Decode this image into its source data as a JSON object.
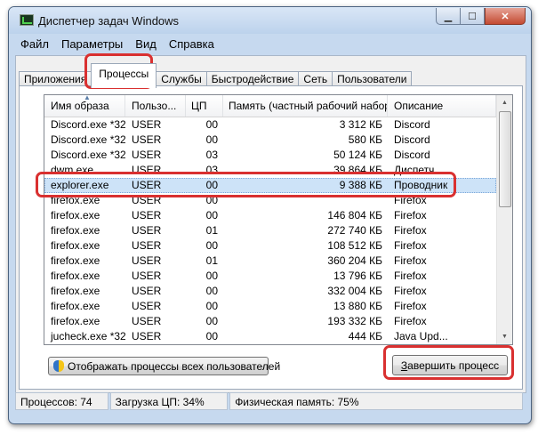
{
  "window": {
    "title": "Диспетчер задач Windows"
  },
  "menu": [
    "Файл",
    "Параметры",
    "Вид",
    "Справка"
  ],
  "tabs": [
    "Приложения",
    "Процессы",
    "Службы",
    "Быстродействие",
    "Сеть",
    "Пользователи"
  ],
  "active_tab": "Процессы",
  "table": {
    "columns": [
      "Имя образа",
      "Пользо...",
      "ЦП",
      "Память (частный рабочий набор)",
      "Описание"
    ],
    "sorted_column": "Имя образа",
    "rows": [
      [
        "Discord.exe *32",
        "USER",
        "00",
        "3 312 КБ",
        "Discord"
      ],
      [
        "Discord.exe *32",
        "USER",
        "00",
        "580 КБ",
        "Discord"
      ],
      [
        "Discord.exe *32",
        "USER",
        "03",
        "50 124 КБ",
        "Discord"
      ],
      [
        "dwm.exe",
        "USER",
        "03",
        "39 864 КБ",
        "Диспетч..."
      ],
      [
        "explorer.exe",
        "USER",
        "00",
        "9 388 КБ",
        "Проводник"
      ],
      [
        "firefox.exe",
        "USER",
        "00",
        "",
        "Firefox"
      ],
      [
        "firefox.exe",
        "USER",
        "00",
        "146 804 КБ",
        "Firefox"
      ],
      [
        "firefox.exe",
        "USER",
        "01",
        "272 740 КБ",
        "Firefox"
      ],
      [
        "firefox.exe",
        "USER",
        "00",
        "108 512 КБ",
        "Firefox"
      ],
      [
        "firefox.exe",
        "USER",
        "01",
        "360 204 КБ",
        "Firefox"
      ],
      [
        "firefox.exe",
        "USER",
        "00",
        "13 796 КБ",
        "Firefox"
      ],
      [
        "firefox.exe",
        "USER",
        "00",
        "332 004 КБ",
        "Firefox"
      ],
      [
        "firefox.exe",
        "USER",
        "00",
        "13 880 КБ",
        "Firefox"
      ],
      [
        "firefox.exe",
        "USER",
        "00",
        "193 332 КБ",
        "Firefox"
      ],
      [
        "jucheck.exe *32",
        "USER",
        "00",
        "444 КБ",
        "Java Upd..."
      ]
    ],
    "selected_row": 4
  },
  "buttons": {
    "show_all": "Отображать процессы всех пользователей",
    "end_task_underlined": "З",
    "end_task_rest": "авершить процесс"
  },
  "status": {
    "processes": "Процессов: 74",
    "cpu": "Загрузка ЦП: 34%",
    "memory": "Физическая память: 75%"
  },
  "colors": {
    "highlight": "#d93030",
    "selection": "#cde3f8"
  }
}
